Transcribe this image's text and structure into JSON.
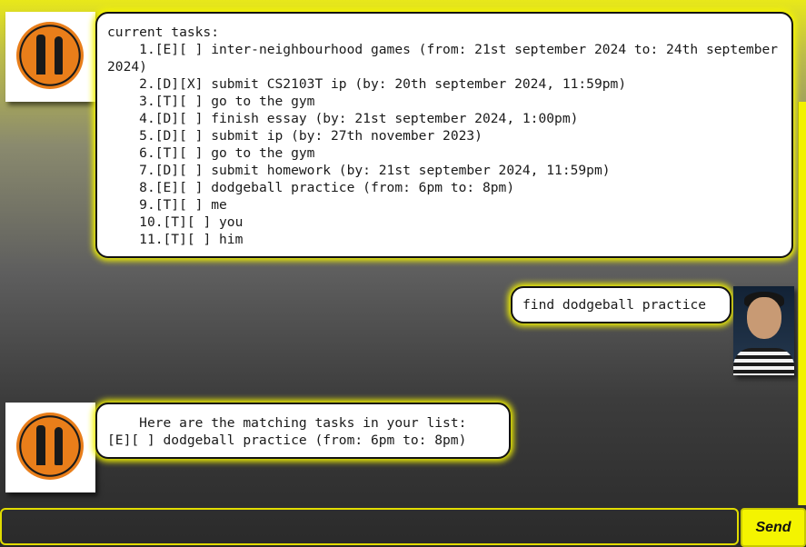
{
  "messages": [
    {
      "sender": "bot",
      "text": "current tasks:\n    1.[E][ ] inter-neighbourhood games (from: 21st september 2024 to: 24th september 2024)\n    2.[D][X] submit CS2103T ip (by: 20th september 2024, 11:59pm)\n    3.[T][ ] go to the gym\n    4.[D][ ] finish essay (by: 21st september 2024, 1:00pm)\n    5.[D][ ] submit ip (by: 27th november 2023)\n    6.[T][ ] go to the gym\n    7.[D][ ] submit homework (by: 21st september 2024, 11:59pm)\n    8.[E][ ] dodgeball practice (from: 6pm to: 8pm)\n    9.[T][ ] me\n    10.[T][ ] you\n    11.[T][ ] him"
    },
    {
      "sender": "user",
      "text": "find dodgeball practice"
    },
    {
      "sender": "bot",
      "text": "    Here are the matching tasks in your list:\n[E][ ] dodgeball practice (from: 6pm to: 8pm)"
    }
  ],
  "input": {
    "value": "",
    "placeholder": ""
  },
  "send_button": {
    "label": "Send"
  },
  "colors": {
    "accent": "#f4f400",
    "bubble": "#ffffff",
    "border": "#111111"
  },
  "icons": {
    "bot_avatar": "greek-vase-logo-icon",
    "user_avatar": "user-photo-icon"
  }
}
